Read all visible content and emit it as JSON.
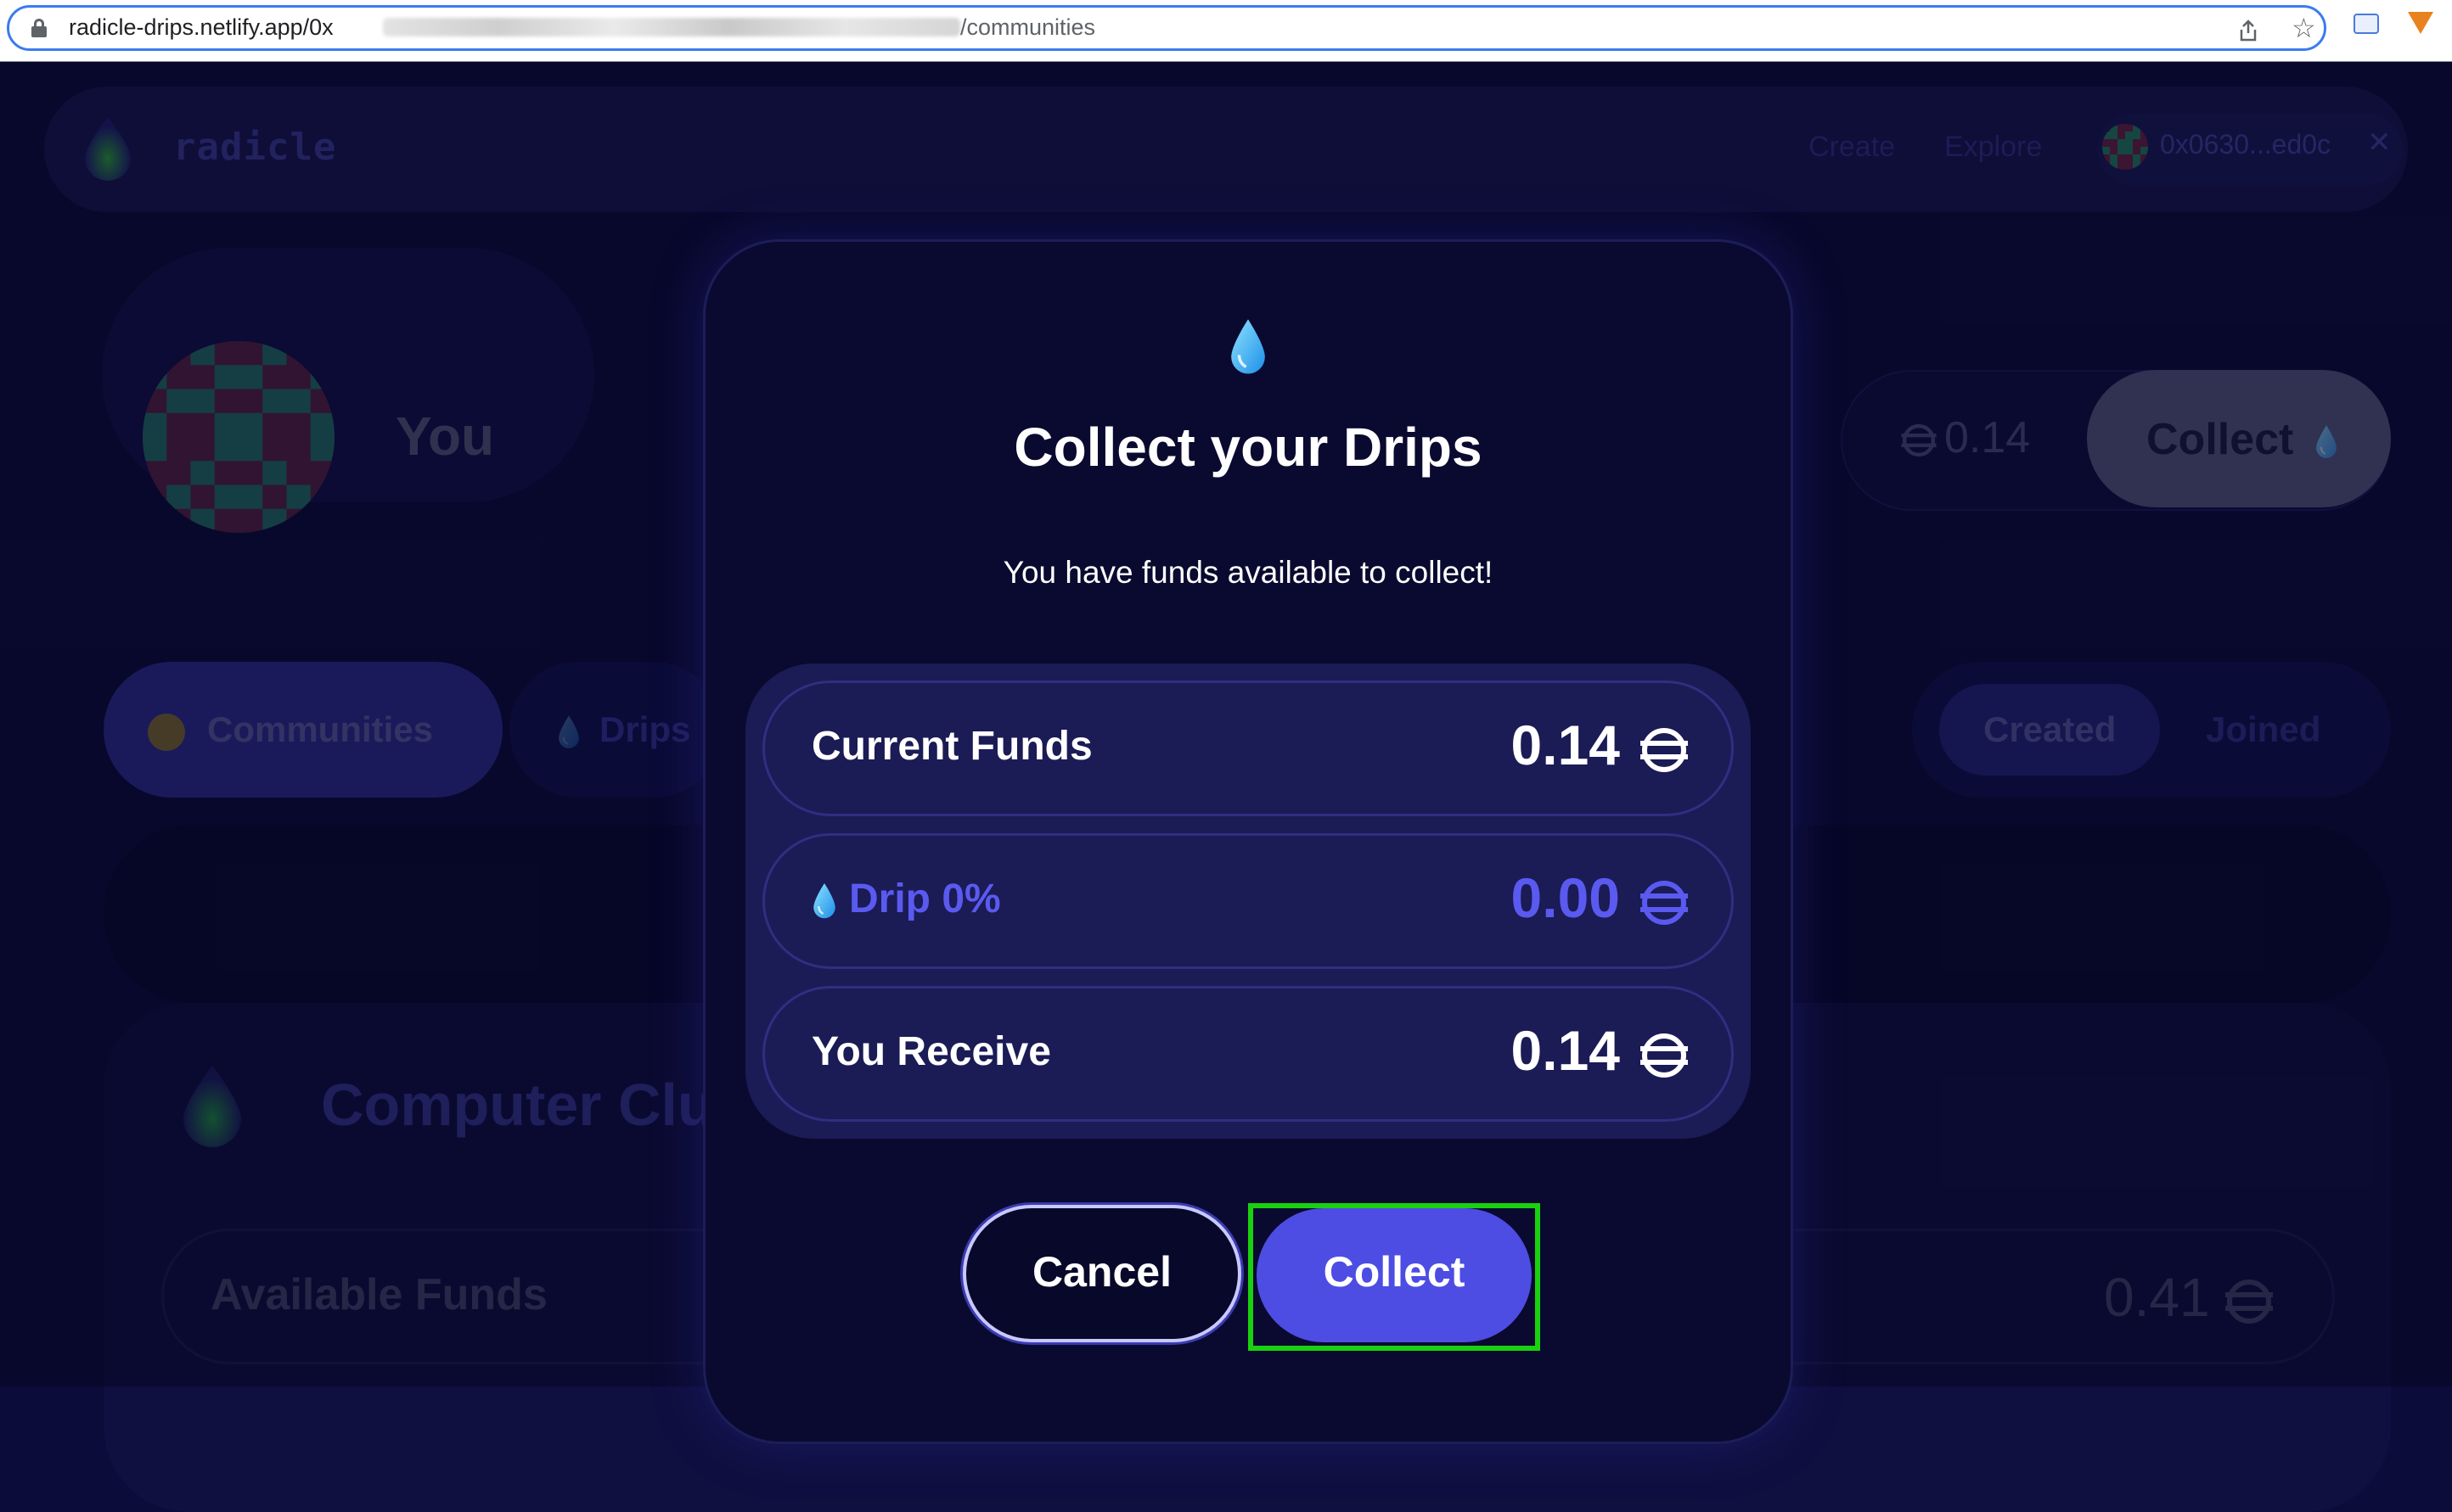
{
  "browser": {
    "url_start": "radicle-drips.netlify.app/0x",
    "url_end": "/communities"
  },
  "nav": {
    "logo": "radicle",
    "links": [
      "Create",
      "Explore"
    ],
    "wallet_address": "0x0630...ed0c"
  },
  "profile": {
    "name": "You"
  },
  "balance": {
    "amount": "0.14",
    "collect_label": "Collect"
  },
  "tabs": {
    "communities": "Communities",
    "drips": "Drips",
    "created": "Created",
    "joined": "Joined"
  },
  "club": {
    "title": "Computer Club",
    "available_funds_label": "Available Funds",
    "available_funds_value": "0.41"
  },
  "modal": {
    "title": "Collect your Drips",
    "subtitle": "You have funds available to collect!",
    "rows": [
      {
        "label": "Current Funds",
        "value": "0.14"
      },
      {
        "label": "Drip 0%",
        "value": "0.00"
      },
      {
        "label": "You Receive",
        "value": "0.14"
      }
    ],
    "cancel_label": "Cancel",
    "collect_label": "Collect"
  },
  "colors": {
    "background": "#0c0c3a",
    "modal": "#0a0a30",
    "accent": "#4d4de3",
    "drip_text": "#5a5af0",
    "highlight": "#19d10f"
  }
}
